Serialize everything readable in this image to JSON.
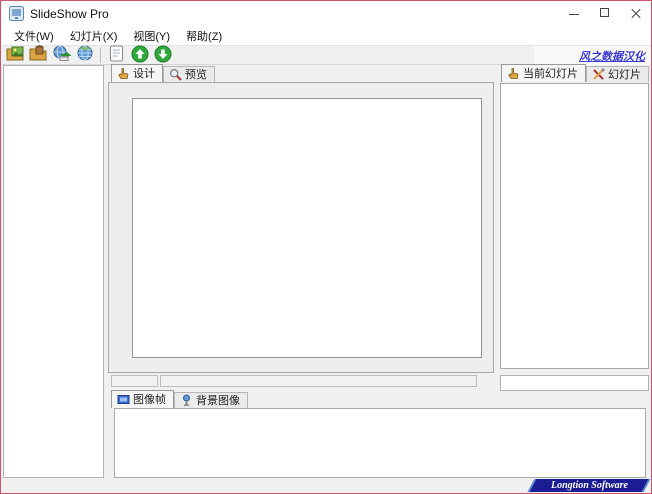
{
  "window": {
    "title": "SlideShow Pro"
  },
  "menu_bar": {
    "items": [
      {
        "label": "文件(W)"
      },
      {
        "label": "幻灯片(X)"
      },
      {
        "label": "视图(Y)"
      },
      {
        "label": "帮助(Z)"
      }
    ]
  },
  "toolbar": {
    "buttons": [
      {
        "icon": "folder-image-icon"
      },
      {
        "icon": "folder-open-icon"
      },
      {
        "icon": "globe-publish-icon"
      },
      {
        "icon": "globe-browse-icon"
      },
      {
        "icon": "document-icon"
      },
      {
        "icon": "up-arrow-icon"
      },
      {
        "icon": "down-arrow-icon"
      }
    ],
    "link_label": "风之数据汉化"
  },
  "design_area": {
    "tabs": [
      {
        "label": "设计",
        "icon": "hand-pointer-icon"
      },
      {
        "label": "预览",
        "icon": "magnifier-icon"
      }
    ]
  },
  "right_panel": {
    "tabs": [
      {
        "label": "当前幻灯片",
        "icon": "hand-pointer-icon"
      },
      {
        "label": "幻灯片",
        "icon": "tools-icon"
      }
    ]
  },
  "bottom_panel": {
    "tabs": [
      {
        "label": "图像帧",
        "icon": "film-frame-icon"
      },
      {
        "label": "背景图像",
        "icon": "picture-icon"
      }
    ]
  },
  "footer": {
    "brand": "Longtion Software"
  },
  "colors": {
    "window_border": "#c9566b",
    "link_text": "#3b3bd6",
    "banner_bg": "#1c1c94",
    "arrow_button_green": "#2fa83c",
    "active_tab_bg": "#f5f5f5"
  }
}
